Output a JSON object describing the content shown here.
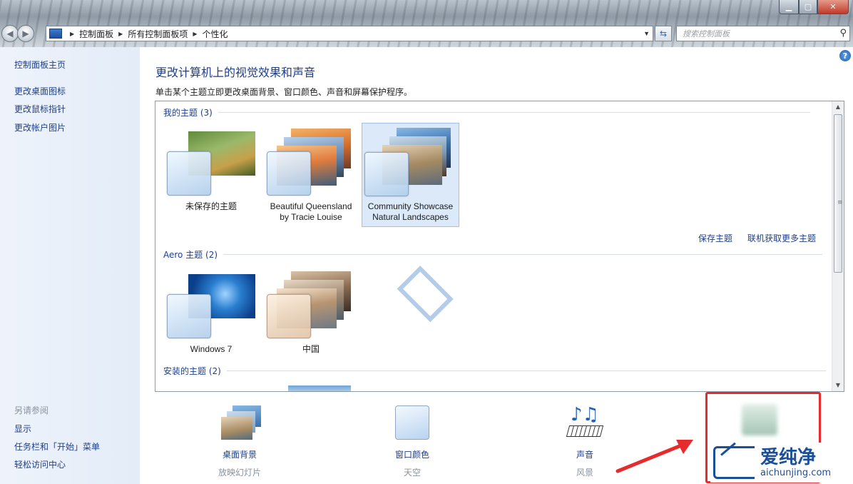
{
  "address_bar": {
    "breadcrumbs": [
      "控制面板",
      "所有控制面板项",
      "个性化"
    ],
    "search_placeholder": "搜索控制面板"
  },
  "left_pane": {
    "links": [
      "控制面板主页",
      "更改桌面图标",
      "更改鼠标指针",
      "更改帐户图片"
    ],
    "see_also_heading": "另请参阅",
    "see_also": [
      "显示",
      "任务栏和「开始」菜单",
      "轻松访问中心"
    ]
  },
  "main": {
    "title": "更改计算机上的视觉效果和声音",
    "description": "单击某个主题立即更改桌面背景、窗口颜色、声音和屏幕保护程序。",
    "groups": {
      "my_themes": "我的主题 (3)",
      "aero_themes": "Aero 主题 (2)",
      "installed_themes": "安装的主题 (2)"
    },
    "my_themes": [
      {
        "name_lines": [
          "未保存的主题"
        ],
        "selected": false
      },
      {
        "name_lines": [
          "Beautiful Queensland",
          "by Tracie Louise"
        ],
        "selected": false
      },
      {
        "name_lines": [
          "Community Showcase",
          "Natural Landscapes"
        ],
        "selected": true
      }
    ],
    "aero_themes": [
      {
        "name_lines": [
          "Windows 7"
        ]
      },
      {
        "name_lines": [
          "中国"
        ]
      }
    ],
    "save_theme_link": "保存主题",
    "get_more_link": "联机获取更多主题"
  },
  "bottom": {
    "items": [
      {
        "label": "桌面背景",
        "sub": "放映幻灯片"
      },
      {
        "label": "窗口颜色",
        "sub": "天空"
      },
      {
        "label": "声音",
        "sub": "风景"
      }
    ]
  },
  "watermark": {
    "text_cn": "爱纯净",
    "url": "aichunjing.com"
  },
  "colors": {
    "link": "#1e3f8a",
    "highlight_box": "#e52b2b",
    "selected_bg": "#dbe9f9"
  }
}
